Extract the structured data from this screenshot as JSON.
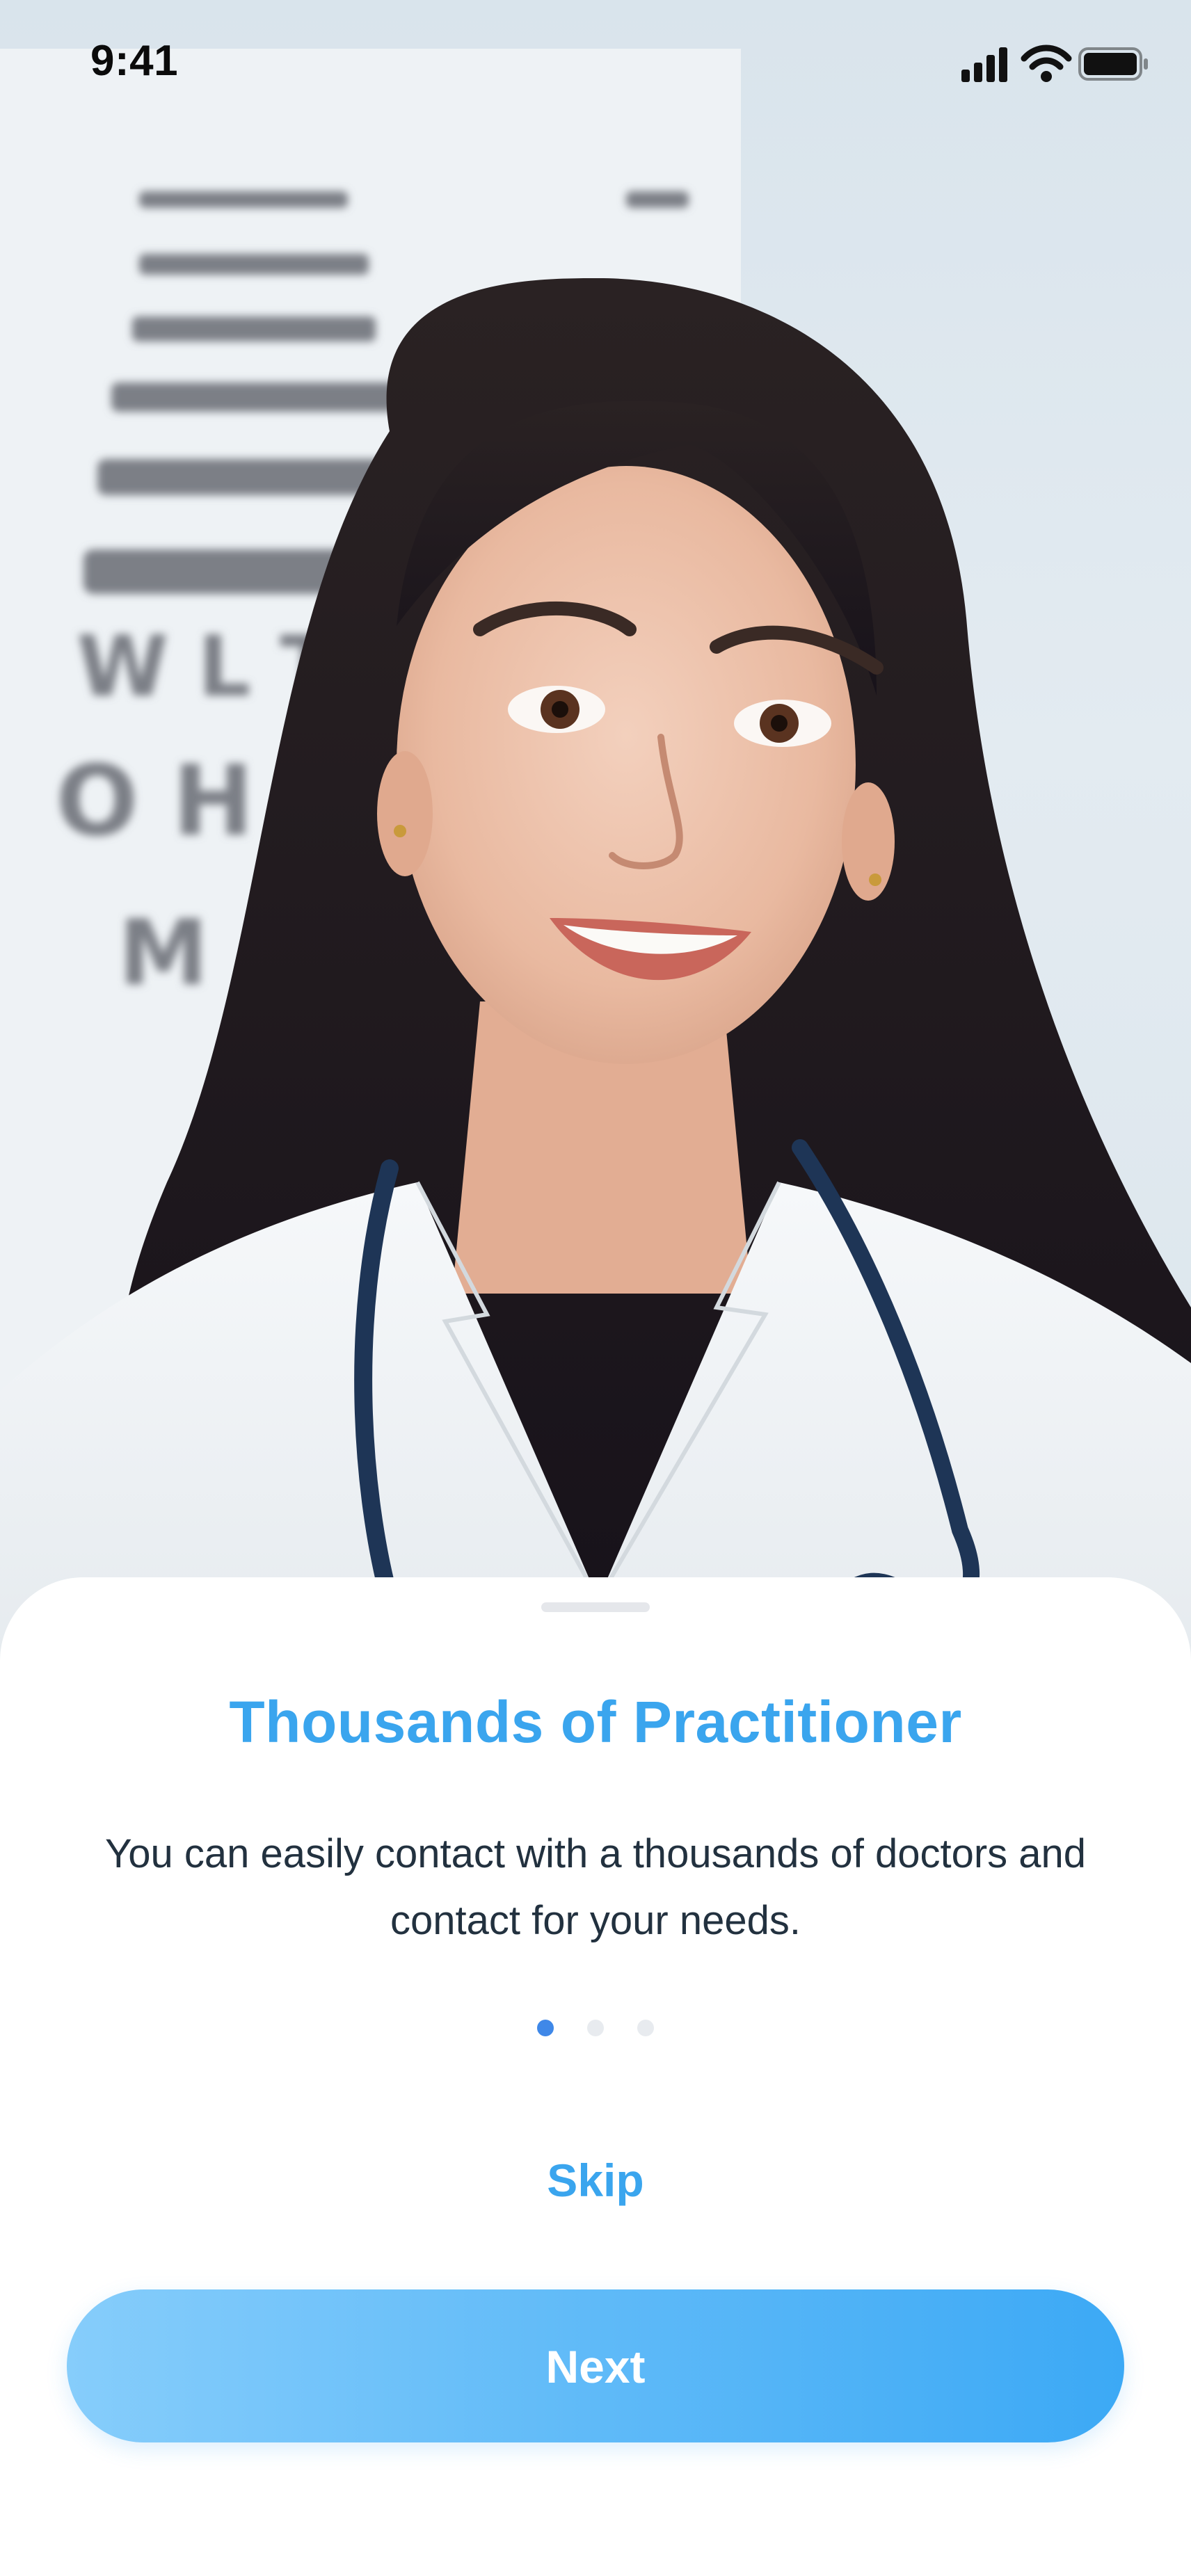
{
  "status_bar": {
    "time": "9:41",
    "icons": [
      "signal-icon",
      "wifi-icon",
      "battery-icon"
    ]
  },
  "hero": {
    "image": "doctor-portrait-photo",
    "chart_letters": [
      "M",
      "O H S",
      "W L T A",
      "K P T R S"
    ]
  },
  "onboarding": {
    "title": "Thousands of Practitioner",
    "description": "You can easily contact with a thousands of doctors and contact for your needs.",
    "page_indicator": {
      "total": 3,
      "active": 1
    },
    "skip_label": "Skip",
    "next_label": "Next"
  },
  "colors": {
    "accent": "#3aa5ee",
    "active_dot": "#3f88e8",
    "button_gradient_start": "#86cdfb",
    "button_gradient_end": "#3ca9f5"
  }
}
